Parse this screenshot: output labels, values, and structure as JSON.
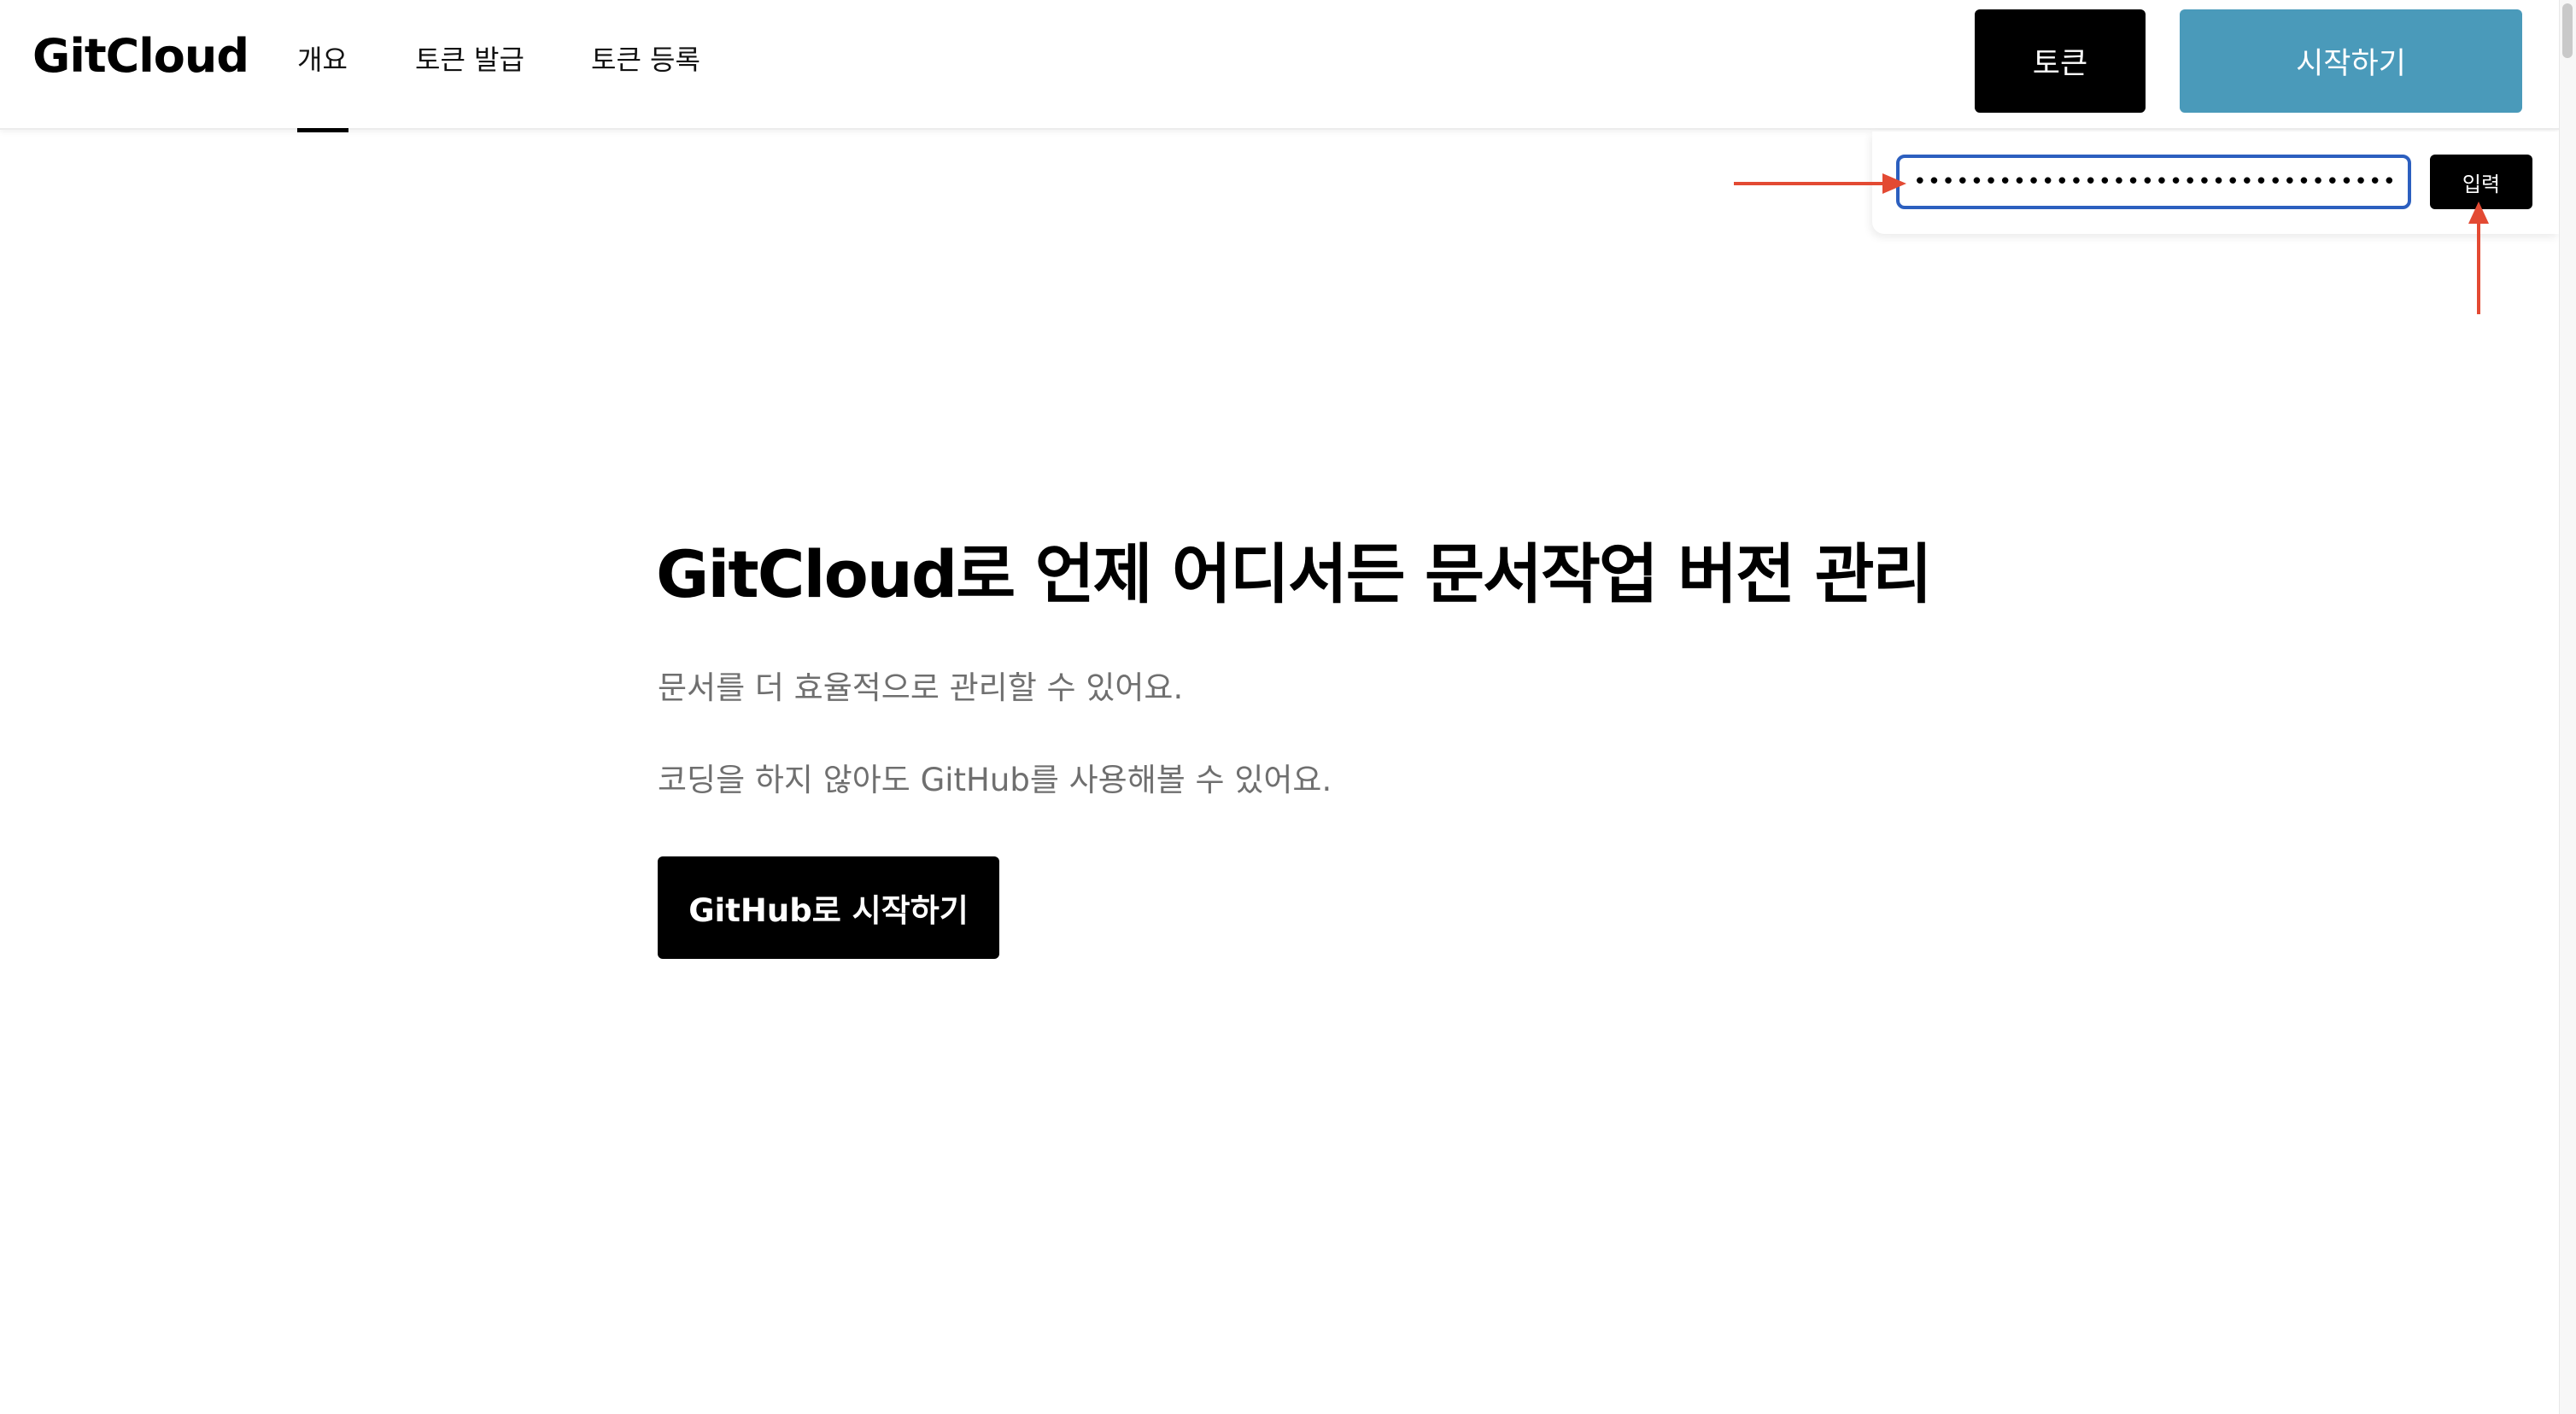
{
  "header": {
    "logo": "GitCloud",
    "nav": [
      {
        "label": "개요",
        "active": true
      },
      {
        "label": "토큰 발급",
        "active": false
      },
      {
        "label": "토큰 등록",
        "active": false
      }
    ],
    "token_button": "토큰",
    "start_button": "시작하기",
    "start_button_color": "#4a9aba"
  },
  "token_panel": {
    "input_value": "••••••••••••••••••••••••••••••••••••••••",
    "submit_label": "입력",
    "input_border_color": "#2c5fbf"
  },
  "annotation": {
    "arrow_color": "#e34a33"
  },
  "hero": {
    "title": "GitCloud로 언제 어디서든 문서작업 버전 관리",
    "subtitle_1": "문서를 더 효율적으로 관리할 수 있어요.",
    "subtitle_2": "코딩을 하지 않아도 GitHub를 사용해볼 수 있어요.",
    "cta_button": "GitHub로 시작하기"
  }
}
